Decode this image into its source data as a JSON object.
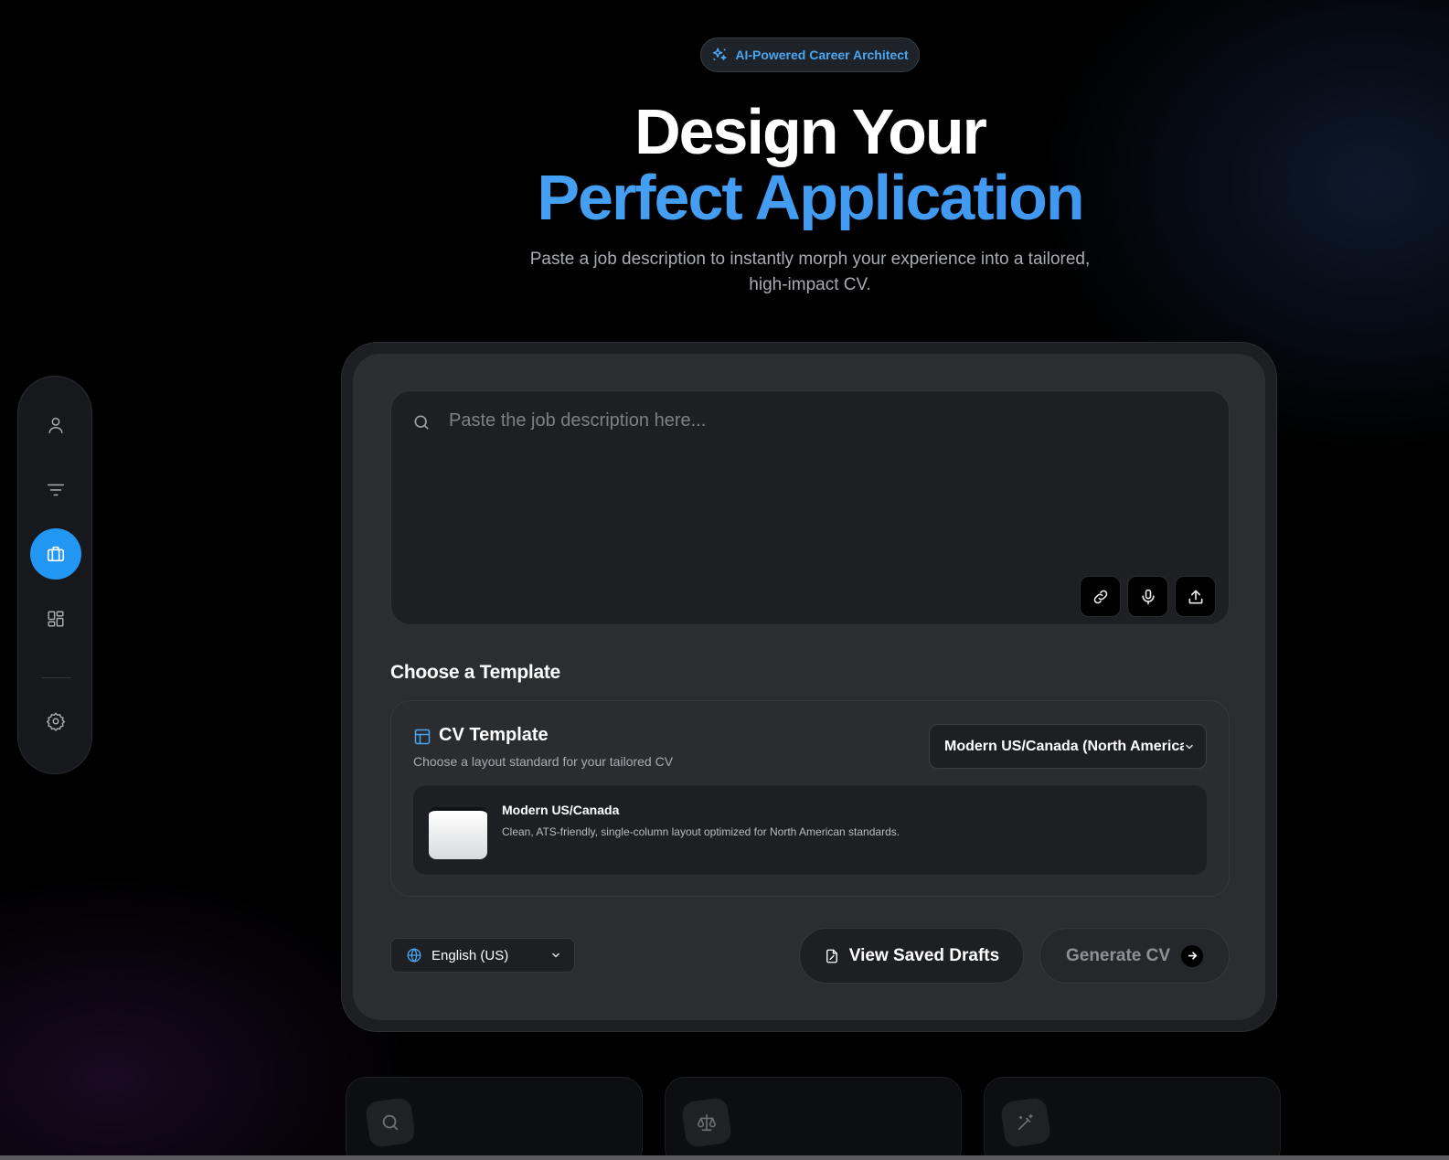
{
  "hero": {
    "badge": "AI-Powered Career Architect",
    "title_line1": "Design Your",
    "title_line2": "Perfect Application",
    "subtitle": "Paste a job description to instantly morph your experience into a tailored, high-impact CV."
  },
  "sidebar": {
    "items": [
      {
        "name": "profile",
        "icon": "user-icon"
      },
      {
        "name": "filters",
        "icon": "filter-icon"
      },
      {
        "name": "jobs",
        "icon": "briefcase-icon",
        "active": true
      },
      {
        "name": "dashboard",
        "icon": "grid-icon"
      },
      {
        "name": "settings",
        "icon": "gear-icon"
      }
    ]
  },
  "job_description": {
    "placeholder": "Paste the job description here...",
    "value": "",
    "tools": [
      "link-icon",
      "microphone-icon",
      "upload-icon"
    ]
  },
  "template_section": {
    "heading": "Choose a Template",
    "panel_title": "CV Template",
    "panel_subtitle": "Choose a layout standard for your tailored CV",
    "selected": "Modern US/Canada (North America)",
    "current_template": {
      "name": "Modern US/Canada",
      "description": "Clean, ATS-friendly, single-column layout optimized for North American standards."
    }
  },
  "actions": {
    "language": "English (US)",
    "view_drafts_label": "View Saved Drafts",
    "generate_label": "Generate CV"
  },
  "features": [
    {
      "icon": "search-icon"
    },
    {
      "icon": "scale-icon"
    },
    {
      "icon": "magic-wand-icon"
    }
  ],
  "colors": {
    "accent": "#2196f3",
    "accent_text": "#4aa6f0",
    "background": "#000000",
    "card": "#2b2d31"
  }
}
